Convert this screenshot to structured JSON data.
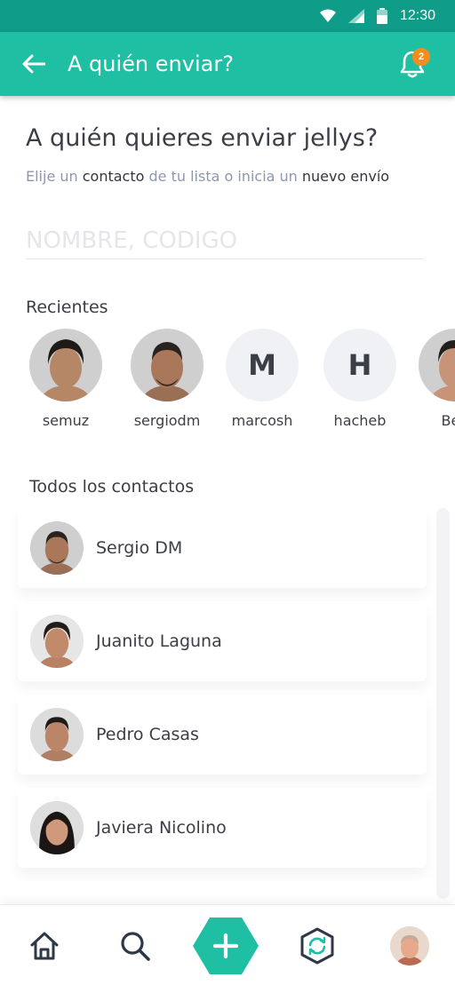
{
  "status_bar": {
    "time": "12:30"
  },
  "app_bar": {
    "title": "A quién enviar?",
    "notification_count": "2",
    "color": "#1fbfa3"
  },
  "heading": "A quién quieres enviar jellys?",
  "subheading": {
    "part1": "Elije un ",
    "part2": "contacto",
    "part3": " de tu lista o inicia un ",
    "part4": "nuevo envío"
  },
  "search": {
    "placeholder": "NOMBRE, CODIGO",
    "value": ""
  },
  "recents": {
    "label": "Recientes",
    "items": [
      {
        "name": "semuz",
        "type": "photo"
      },
      {
        "name": "sergiodm",
        "type": "photo"
      },
      {
        "name": "marcosh",
        "type": "initial",
        "initial": "M"
      },
      {
        "name": "hacheb",
        "type": "initial",
        "initial": "H"
      },
      {
        "name": "Ben",
        "type": "photo"
      }
    ]
  },
  "contacts": {
    "label": "Todos los contactos",
    "items": [
      {
        "name": "Sergio DM"
      },
      {
        "name": "Juanito Laguna"
      },
      {
        "name": "Pedro Casas"
      },
      {
        "name": "Javiera Nicolino"
      }
    ]
  },
  "bottom_nav": {
    "items": [
      "home-icon",
      "search-icon",
      "add-icon",
      "sync-icon",
      "profile-avatar"
    ],
    "accent": "#1fbfa3"
  }
}
